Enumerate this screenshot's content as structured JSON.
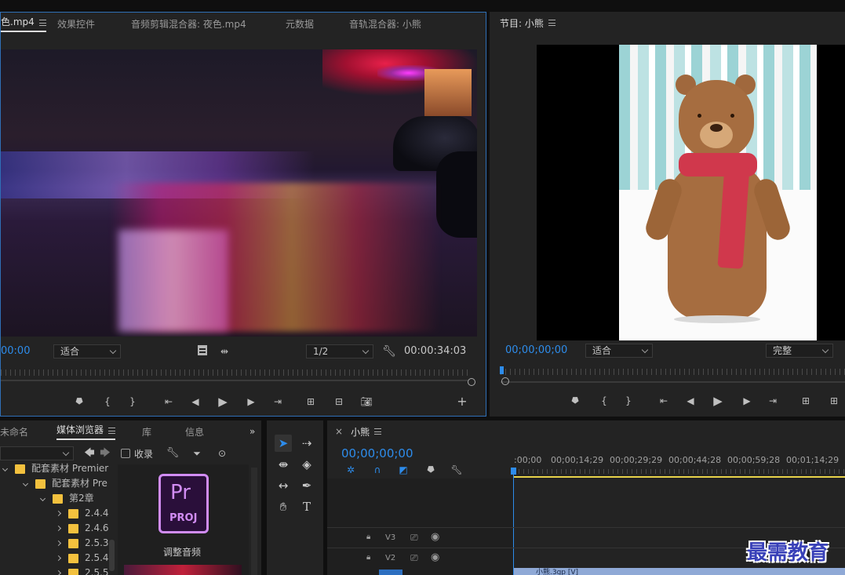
{
  "source_monitor": {
    "tabs": [
      "色.mp4",
      "效果控件",
      "音频剪辑混合器: 夜色.mp4",
      "元数据",
      "音轨混合器: 小熊"
    ],
    "timecode_in": "00:00",
    "fit_label": "适合",
    "resolution_label": "1/2",
    "duration": "00:00:34:03"
  },
  "program_monitor": {
    "title": "节目: 小熊",
    "timecode": "00;00;00;00",
    "fit_label": "适合",
    "quality_label": "完整"
  },
  "project_panel": {
    "tabs": [
      "未命名",
      "媒体浏览器",
      "库",
      "信息"
    ],
    "favorites_label": "收录",
    "tree": [
      {
        "label": "配套素材 Premier",
        "level": 0
      },
      {
        "label": "配套素材 Pre",
        "level": 1
      },
      {
        "label": "第2章",
        "level": 2
      },
      {
        "label": "2.4.4",
        "level": 3
      },
      {
        "label": "2.4.6",
        "level": 3
      },
      {
        "label": "2.5.3",
        "level": 3
      },
      {
        "label": "2.5.4",
        "level": 3
      },
      {
        "label": "2.5.5",
        "level": 3
      }
    ],
    "thumbnail_badge": "Pr",
    "thumbnail_badge_sub": "PROJ",
    "thumbnail_caption": "调整音频"
  },
  "timeline": {
    "sequence_name": "小熊",
    "timecode": "00;00;00;00",
    "ruler_ticks": [
      ":00;00",
      "00;00;14;29",
      "00;00;29;29",
      "00;00;44;28",
      "00;00;59;28",
      "00;01;14;29"
    ],
    "tracks": [
      "V3",
      "V2"
    ],
    "clip_label": "小熊.3gp [V]"
  },
  "watermark": "最需教育",
  "colors": {
    "accent_blue": "#2d8ceb",
    "panel_bg": "#232323",
    "folder_yellow": "#f3c13e",
    "pr_purple": "#d18cf3",
    "playhead_yellow": "#e8d34a",
    "clip_blue": "#8fa9d6"
  }
}
